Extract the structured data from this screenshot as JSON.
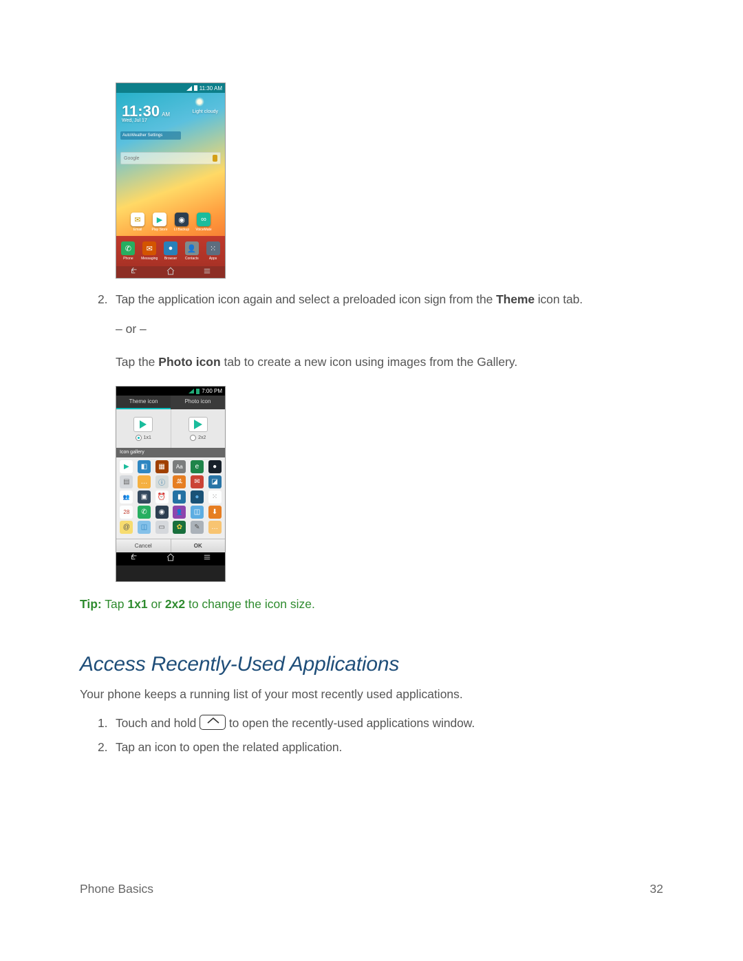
{
  "figure1": {
    "status_time": "11:30 AM",
    "clock_time": "11:30",
    "clock_ampm": "AM",
    "clock_date": "Wed, Jul 17",
    "weather_label": "Light cloudy",
    "widget_bar": "AutoWeather Settings",
    "search_placeholder": "Google",
    "row_icons": [
      {
        "label": "Email",
        "glyph": "✉",
        "bg": "#fff",
        "fg": "#c79a00"
      },
      {
        "label": "Play Store",
        "glyph": "▶",
        "bg": "#fff",
        "fg": "#1abc9c"
      },
      {
        "label": "LI Backup",
        "glyph": "◉",
        "bg": "#2c3e50",
        "fg": "#fff"
      },
      {
        "label": "VoiceMate",
        "glyph": "∞",
        "bg": "#1abc9c",
        "fg": "#fff"
      }
    ],
    "dock_icons": [
      {
        "label": "Phone",
        "glyph": "✆",
        "bg": "#27ae60"
      },
      {
        "label": "Messaging",
        "glyph": "✉",
        "bg": "#d35400"
      },
      {
        "label": "Browser",
        "glyph": "●",
        "bg": "#2980b9"
      },
      {
        "label": "Contacts",
        "glyph": "👤",
        "bg": "#7f8c8d"
      },
      {
        "label": "Apps",
        "glyph": "⁙",
        "bg": "#5d6d7e"
      }
    ]
  },
  "step2": {
    "num": "2.",
    "t1": "Tap the application icon again and select a preloaded icon sign from the ",
    "bold1": "Theme",
    "t2": " icon tab.",
    "or": "– or –",
    "t3": "Tap the ",
    "bold2": "Photo icon",
    "t4": " tab to create a new icon using images from the Gallery."
  },
  "figure2": {
    "status_time": "7:00 PM",
    "tab_theme": "Theme icon",
    "tab_photo": "Photo icon",
    "size_1x1": "1x1",
    "size_2x2": "2x2",
    "gallery_label": "Icon gallery",
    "grid": [
      [
        {
          "g": "▶",
          "bg": "#fff",
          "fg": "#1abc9c"
        },
        {
          "g": "◧",
          "bg": "#2e86c1",
          "fg": "#fff"
        },
        {
          "g": "▦",
          "bg": "#a04000",
          "fg": "#fff"
        },
        {
          "g": "Aa",
          "bg": "#7b7d7d",
          "fg": "#fff"
        },
        {
          "g": "e",
          "bg": "#1e8449",
          "fg": "#fff"
        },
        {
          "g": "●",
          "bg": "#17202a",
          "fg": "#fff"
        }
      ],
      [
        {
          "g": "▤",
          "bg": "#d5d8dc",
          "fg": "#666"
        },
        {
          "g": "…",
          "bg": "#f5b041",
          "fg": "#fff"
        },
        {
          "g": "ⓘ",
          "bg": "#d5dbdb",
          "fg": "#2874a6"
        },
        {
          "g": "ꔛ",
          "bg": "#e67e22",
          "fg": "#fff"
        },
        {
          "g": "✉",
          "bg": "#cb4335",
          "fg": "#fff"
        },
        {
          "g": "◪",
          "bg": "#2874a6",
          "fg": "#fff"
        }
      ],
      [
        {
          "g": "👥",
          "bg": "#fdfefe",
          "fg": "#555"
        },
        {
          "g": "▣",
          "bg": "#34495e",
          "fg": "#fff"
        },
        {
          "g": "⏰",
          "bg": "#fdfefe",
          "fg": "#c0392b"
        },
        {
          "g": "▮",
          "bg": "#2471a3",
          "fg": "#fff"
        },
        {
          "g": "●",
          "bg": "#1a5276",
          "fg": "#5dade2"
        },
        {
          "g": "⁙",
          "bg": "#fdfefe",
          "fg": "#888"
        }
      ],
      [
        {
          "g": "28",
          "bg": "#fdfefe",
          "fg": "#c0392b"
        },
        {
          "g": "✆",
          "bg": "#27ae60",
          "fg": "#fff"
        },
        {
          "g": "◉",
          "bg": "#2c3e50",
          "fg": "#fff"
        },
        {
          "g": "👤",
          "bg": "#8e44ad",
          "fg": "#fff"
        },
        {
          "g": "◫",
          "bg": "#5dade2",
          "fg": "#fff"
        },
        {
          "g": "⬇",
          "bg": "#e67e22",
          "fg": "#fff"
        }
      ],
      [
        {
          "g": "@",
          "bg": "#f7dc6f",
          "fg": "#555"
        },
        {
          "g": "◫",
          "bg": "#85c1e9",
          "fg": "#2e86c1"
        },
        {
          "g": "▭",
          "bg": "#d5d8dc",
          "fg": "#555"
        },
        {
          "g": "✿",
          "bg": "#196f3d",
          "fg": "#f4d03f"
        },
        {
          "g": "✎",
          "bg": "#abb2b9",
          "fg": "#555"
        },
        {
          "g": "…",
          "bg": "#f8c471",
          "fg": "#fff"
        }
      ]
    ],
    "btn_cancel": "Cancel",
    "btn_ok": "OK"
  },
  "tip": {
    "tip": "Tip:",
    "t1": " Tap ",
    "b1": "1x1",
    "t2": " or ",
    "b2": "2x2",
    "t3": " to change the icon size."
  },
  "section": {
    "heading": "Access Recently-Used Applications",
    "intro": "Your phone keeps a running list of your most recently used applications.",
    "s1num": "1.",
    "s1a": "Touch and hold ",
    "s1b": " to open the recently-used applications window.",
    "s2num": "2.",
    "s2": "Tap an icon to open the related application."
  },
  "footer": {
    "left": "Phone Basics",
    "right": "32"
  }
}
